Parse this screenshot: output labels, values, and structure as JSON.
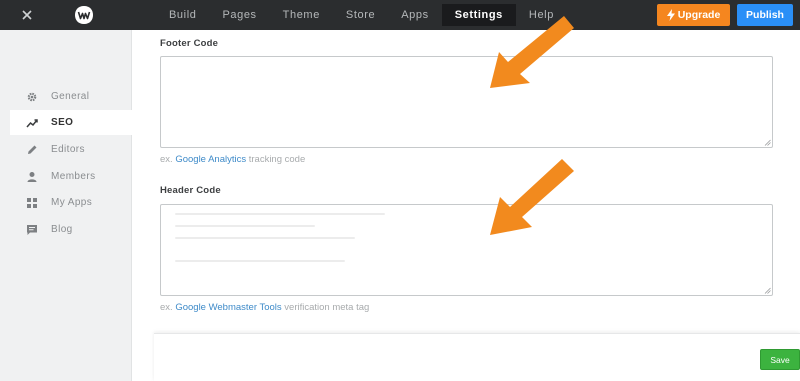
{
  "topbar": {
    "nav": [
      "Build",
      "Pages",
      "Theme",
      "Store",
      "Apps",
      "Settings",
      "Help"
    ],
    "active_nav": "Settings",
    "upgrade_label": "Upgrade",
    "publish_label": "Publish"
  },
  "sidebar": {
    "items": [
      {
        "label": "General",
        "icon": "gear-icon"
      },
      {
        "label": "SEO",
        "icon": "trending-up-icon"
      },
      {
        "label": "Editors",
        "icon": "pencil-icon"
      },
      {
        "label": "Members",
        "icon": "person-icon"
      },
      {
        "label": "My Apps",
        "icon": "apps-grid-icon"
      },
      {
        "label": "Blog",
        "icon": "comment-icon"
      }
    ],
    "active": "SEO"
  },
  "main": {
    "footer_code": {
      "label": "Footer Code",
      "value": "",
      "hint_prefix": "ex.",
      "hint_link": "Google Analytics",
      "hint_suffix": "tracking code"
    },
    "header_code": {
      "label": "Header Code",
      "hint_prefix": "ex.",
      "hint_link": "Google Webmaster Tools",
      "hint_suffix": "verification meta tag"
    },
    "save_label": "Save"
  },
  "colors": {
    "topbar": "#2b2d2f",
    "upgrade": "#f5861f",
    "publish": "#2a8ff7",
    "save": "#3cb33f",
    "link": "#3f8bc9",
    "annotation_arrow": "#f28a1e"
  }
}
